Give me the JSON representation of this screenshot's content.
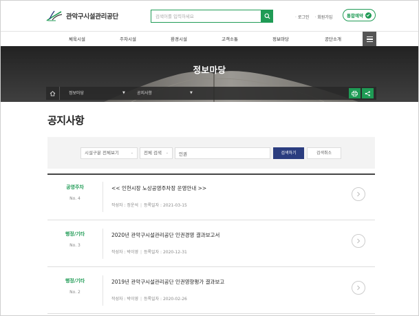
{
  "header": {
    "logo_text": "관악구시설관리공단",
    "search_placeholder": "검색어를 입력하세요",
    "util_links": [
      "로그인",
      "회원가입"
    ],
    "reserve_label": "통합예약"
  },
  "nav": {
    "items": [
      "체육시설",
      "주차시설",
      "환경시설",
      "고객소통",
      "정보마당",
      "공단소개"
    ]
  },
  "banner": {
    "title": "정보마당",
    "breadcrumb": [
      "정보마당",
      "공지사항"
    ]
  },
  "page": {
    "title": "공지사항"
  },
  "filter": {
    "facility_select": "시설구분 전체보기",
    "scope_select": "전체 검색",
    "keyword_value": "인권",
    "search_label": "검색하기",
    "cancel_label": "검색취소"
  },
  "list": {
    "author_prefix": "작성자 :",
    "date_prefix": "등록일자 :",
    "rows": [
      {
        "category": "공영주차",
        "no": "No. 4",
        "title": "<< 인헌시장 노상공영주차장 운영안내 >>",
        "author": "정운석",
        "date": "2021-03-15"
      },
      {
        "category": "행정/기타",
        "no": "No. 3",
        "title": "2020년 관악구시설관리공단 인권경영 결과보고서",
        "author": "박이영",
        "date": "2020-12-31"
      },
      {
        "category": "행정/기타",
        "no": "No. 2",
        "title": "2019년 관악구시설관리공단 인권영향평가 결과보고",
        "author": "박이영",
        "date": "2020-02-26"
      }
    ]
  },
  "colors": {
    "brand_green": "#1f9b55",
    "search_navy": "#2b3d7f"
  },
  "icons": [
    "logo-leaf-icon",
    "search-icon",
    "check-icon",
    "menu-icon",
    "home-icon",
    "print-icon",
    "share-icon",
    "chevron-right-icon"
  ]
}
